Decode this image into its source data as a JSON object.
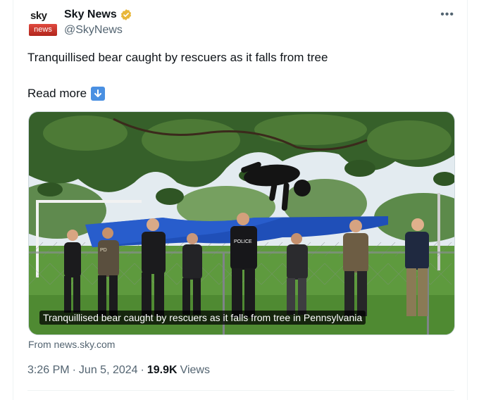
{
  "author": {
    "display_name": "Sky News",
    "handle": "@SkyNews",
    "logo_top": "sky",
    "logo_bottom": "news"
  },
  "tweet": {
    "text": "Tranquillised bear caught by rescuers as it falls from tree",
    "read_more": "Read more"
  },
  "media": {
    "caption": "Tranquillised bear caught by rescuers as it falls from tree in Pennsylvania",
    "vest_label_left": "PD",
    "vest_label_center": "POLICE"
  },
  "link_source": "From news.sky.com",
  "meta": {
    "time": "3:26 PM",
    "sep1": "·",
    "date": "Jun 5, 2024",
    "sep2": "·",
    "views_count": "19.9K",
    "views_label": "Views"
  },
  "colors": {
    "verified": "#e8b73a",
    "link_arrow": "#4a90e2",
    "tarp": "#1f4fb8"
  }
}
